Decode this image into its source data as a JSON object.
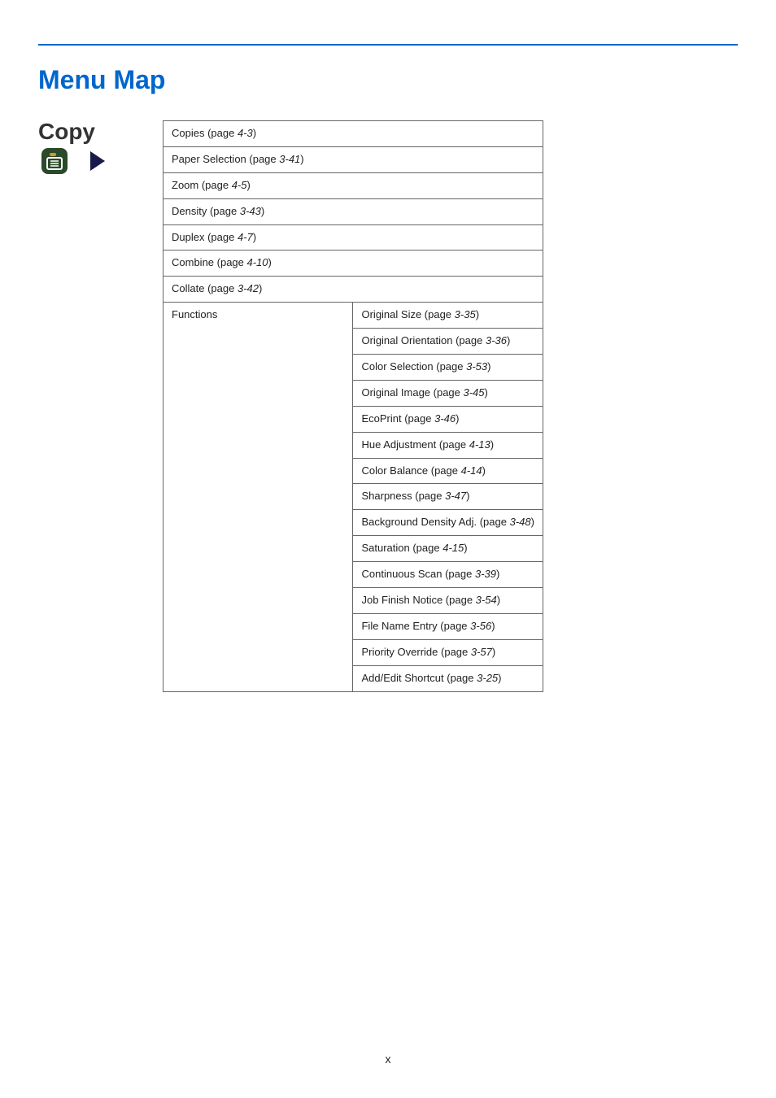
{
  "title": "Menu Map",
  "icon_label": "Copy",
  "page_number": "x",
  "top_rows": [
    {
      "label": "Copies",
      "page": "4-3"
    },
    {
      "label": "Paper Selection",
      "page": "3-41"
    },
    {
      "label": "Zoom",
      "page": "4-5"
    },
    {
      "label": "Density",
      "page": "3-43"
    },
    {
      "label": "Duplex",
      "page": "4-7"
    },
    {
      "label": "Combine",
      "page": "4-10"
    },
    {
      "label": "Collate",
      "page": "3-42"
    }
  ],
  "functions_label": "Functions",
  "functions_items": [
    {
      "label": "Original Size",
      "page": "3-35"
    },
    {
      "label": "Original Orientation",
      "page": "3-36"
    },
    {
      "label": "Color Selection",
      "page": "3-53"
    },
    {
      "label": "Original Image",
      "page": "3-45"
    },
    {
      "label": "EcoPrint",
      "page": "3-46"
    },
    {
      "label": "Hue Adjustment",
      "page": "4-13"
    },
    {
      "label": "Color Balance",
      "page": "4-14"
    },
    {
      "label": "Sharpness",
      "page": "3-47"
    },
    {
      "label": "Background Density Adj.",
      "page": "3-48"
    },
    {
      "label": "Saturation",
      "page": "4-15"
    },
    {
      "label": "Continuous Scan",
      "page": "3-39"
    },
    {
      "label": "Job Finish Notice",
      "page": "3-54"
    },
    {
      "label": "File Name Entry",
      "page": "3-56"
    },
    {
      "label": "Priority Override",
      "page": "3-57"
    },
    {
      "label": "Add/Edit Shortcut",
      "page": "3-25"
    }
  ],
  "page_word": "page"
}
